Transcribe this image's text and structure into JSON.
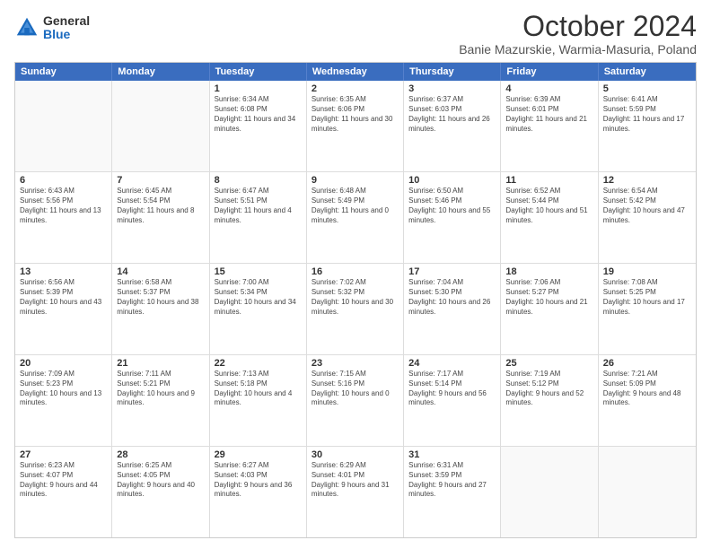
{
  "logo": {
    "general": "General",
    "blue": "Blue"
  },
  "title": "October 2024",
  "location": "Banie Mazurskie, Warmia-Masuria, Poland",
  "header_days": [
    "Sunday",
    "Monday",
    "Tuesday",
    "Wednesday",
    "Thursday",
    "Friday",
    "Saturday"
  ],
  "weeks": [
    [
      {
        "day": "",
        "text": ""
      },
      {
        "day": "",
        "text": ""
      },
      {
        "day": "1",
        "text": "Sunrise: 6:34 AM\nSunset: 6:08 PM\nDaylight: 11 hours and 34 minutes."
      },
      {
        "day": "2",
        "text": "Sunrise: 6:35 AM\nSunset: 6:06 PM\nDaylight: 11 hours and 30 minutes."
      },
      {
        "day": "3",
        "text": "Sunrise: 6:37 AM\nSunset: 6:03 PM\nDaylight: 11 hours and 26 minutes."
      },
      {
        "day": "4",
        "text": "Sunrise: 6:39 AM\nSunset: 6:01 PM\nDaylight: 11 hours and 21 minutes."
      },
      {
        "day": "5",
        "text": "Sunrise: 6:41 AM\nSunset: 5:59 PM\nDaylight: 11 hours and 17 minutes."
      }
    ],
    [
      {
        "day": "6",
        "text": "Sunrise: 6:43 AM\nSunset: 5:56 PM\nDaylight: 11 hours and 13 minutes."
      },
      {
        "day": "7",
        "text": "Sunrise: 6:45 AM\nSunset: 5:54 PM\nDaylight: 11 hours and 8 minutes."
      },
      {
        "day": "8",
        "text": "Sunrise: 6:47 AM\nSunset: 5:51 PM\nDaylight: 11 hours and 4 minutes."
      },
      {
        "day": "9",
        "text": "Sunrise: 6:48 AM\nSunset: 5:49 PM\nDaylight: 11 hours and 0 minutes."
      },
      {
        "day": "10",
        "text": "Sunrise: 6:50 AM\nSunset: 5:46 PM\nDaylight: 10 hours and 55 minutes."
      },
      {
        "day": "11",
        "text": "Sunrise: 6:52 AM\nSunset: 5:44 PM\nDaylight: 10 hours and 51 minutes."
      },
      {
        "day": "12",
        "text": "Sunrise: 6:54 AM\nSunset: 5:42 PM\nDaylight: 10 hours and 47 minutes."
      }
    ],
    [
      {
        "day": "13",
        "text": "Sunrise: 6:56 AM\nSunset: 5:39 PM\nDaylight: 10 hours and 43 minutes."
      },
      {
        "day": "14",
        "text": "Sunrise: 6:58 AM\nSunset: 5:37 PM\nDaylight: 10 hours and 38 minutes."
      },
      {
        "day": "15",
        "text": "Sunrise: 7:00 AM\nSunset: 5:34 PM\nDaylight: 10 hours and 34 minutes."
      },
      {
        "day": "16",
        "text": "Sunrise: 7:02 AM\nSunset: 5:32 PM\nDaylight: 10 hours and 30 minutes."
      },
      {
        "day": "17",
        "text": "Sunrise: 7:04 AM\nSunset: 5:30 PM\nDaylight: 10 hours and 26 minutes."
      },
      {
        "day": "18",
        "text": "Sunrise: 7:06 AM\nSunset: 5:27 PM\nDaylight: 10 hours and 21 minutes."
      },
      {
        "day": "19",
        "text": "Sunrise: 7:08 AM\nSunset: 5:25 PM\nDaylight: 10 hours and 17 minutes."
      }
    ],
    [
      {
        "day": "20",
        "text": "Sunrise: 7:09 AM\nSunset: 5:23 PM\nDaylight: 10 hours and 13 minutes."
      },
      {
        "day": "21",
        "text": "Sunrise: 7:11 AM\nSunset: 5:21 PM\nDaylight: 10 hours and 9 minutes."
      },
      {
        "day": "22",
        "text": "Sunrise: 7:13 AM\nSunset: 5:18 PM\nDaylight: 10 hours and 4 minutes."
      },
      {
        "day": "23",
        "text": "Sunrise: 7:15 AM\nSunset: 5:16 PM\nDaylight: 10 hours and 0 minutes."
      },
      {
        "day": "24",
        "text": "Sunrise: 7:17 AM\nSunset: 5:14 PM\nDaylight: 9 hours and 56 minutes."
      },
      {
        "day": "25",
        "text": "Sunrise: 7:19 AM\nSunset: 5:12 PM\nDaylight: 9 hours and 52 minutes."
      },
      {
        "day": "26",
        "text": "Sunrise: 7:21 AM\nSunset: 5:09 PM\nDaylight: 9 hours and 48 minutes."
      }
    ],
    [
      {
        "day": "27",
        "text": "Sunrise: 6:23 AM\nSunset: 4:07 PM\nDaylight: 9 hours and 44 minutes."
      },
      {
        "day": "28",
        "text": "Sunrise: 6:25 AM\nSunset: 4:05 PM\nDaylight: 9 hours and 40 minutes."
      },
      {
        "day": "29",
        "text": "Sunrise: 6:27 AM\nSunset: 4:03 PM\nDaylight: 9 hours and 36 minutes."
      },
      {
        "day": "30",
        "text": "Sunrise: 6:29 AM\nSunset: 4:01 PM\nDaylight: 9 hours and 31 minutes."
      },
      {
        "day": "31",
        "text": "Sunrise: 6:31 AM\nSunset: 3:59 PM\nDaylight: 9 hours and 27 minutes."
      },
      {
        "day": "",
        "text": ""
      },
      {
        "day": "",
        "text": ""
      }
    ]
  ]
}
